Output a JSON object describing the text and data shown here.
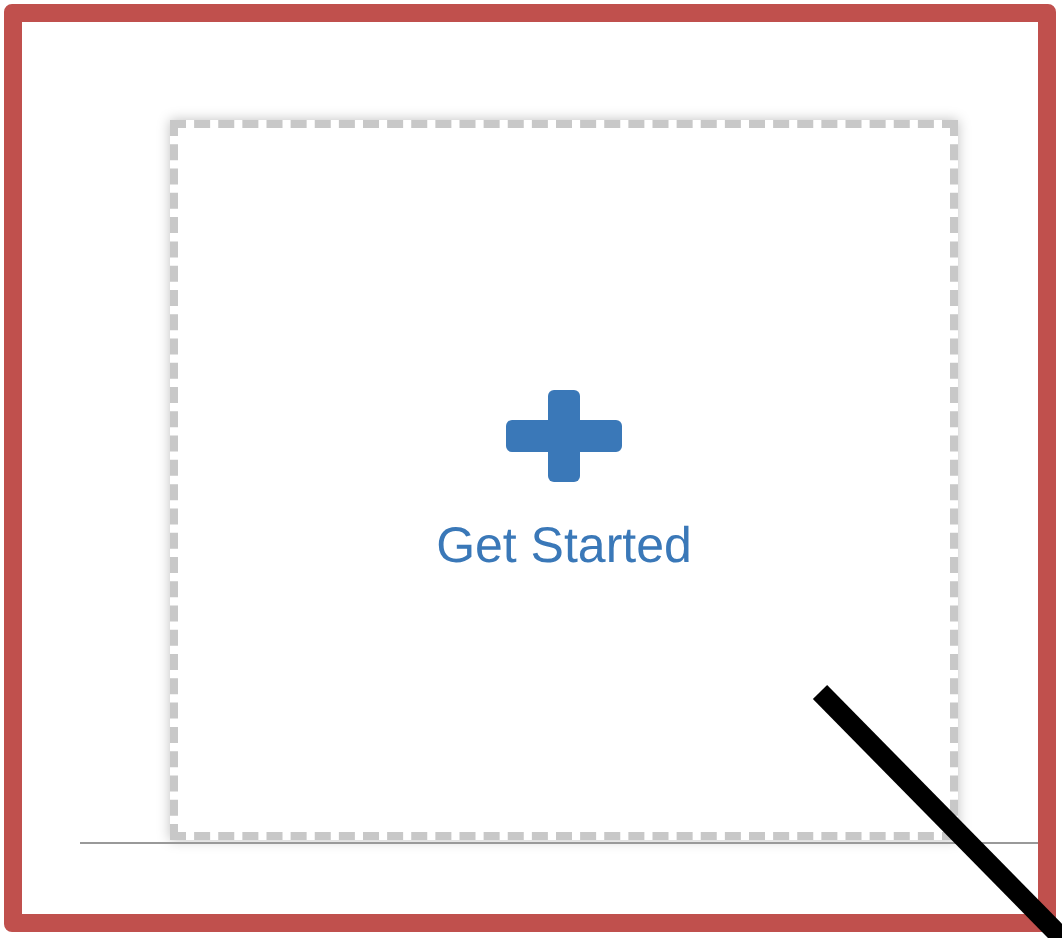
{
  "card": {
    "label": "Get Started"
  }
}
